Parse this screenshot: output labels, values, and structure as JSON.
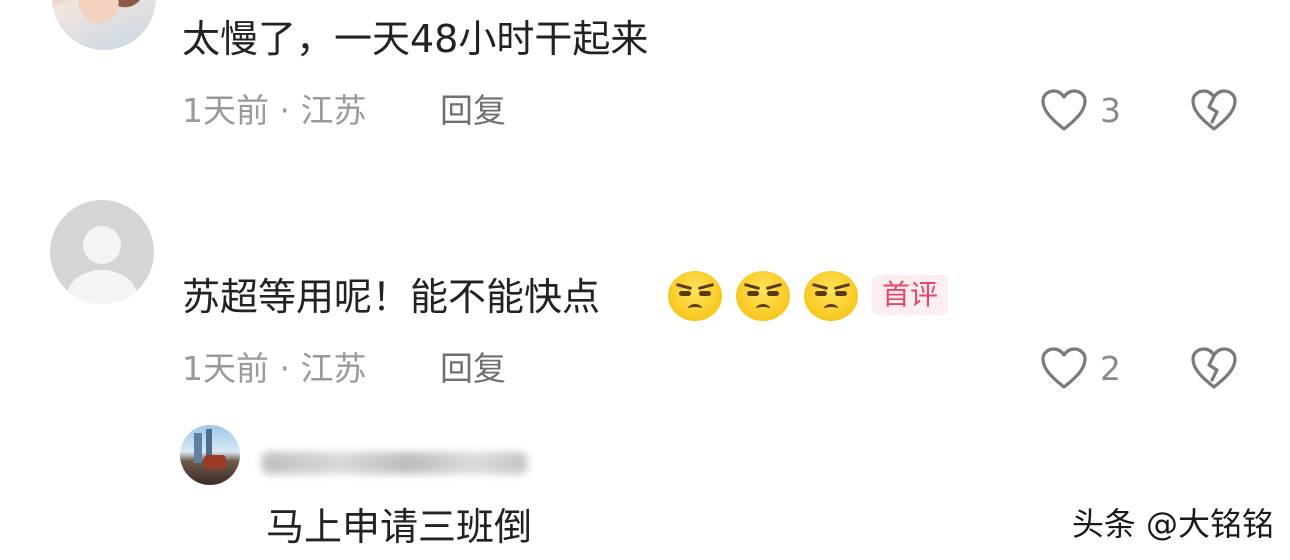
{
  "comments": [
    {
      "text": "太慢了，一天48小时干起来",
      "meta": "1天前 · 江苏",
      "reply_label": "回复",
      "likes": "3"
    },
    {
      "text": "苏超等用呢！能不能快点",
      "badge": "首评",
      "meta": "1天前 · 江苏",
      "reply_label": "回复",
      "likes": "2"
    }
  ],
  "sub_reply": {
    "text": "马上申请三班倒"
  },
  "watermark": "头条 @大铭铭",
  "colors": {
    "badge_text": "#e8456b",
    "badge_bg": "#fdeef1",
    "meta": "#9a9a9a"
  }
}
